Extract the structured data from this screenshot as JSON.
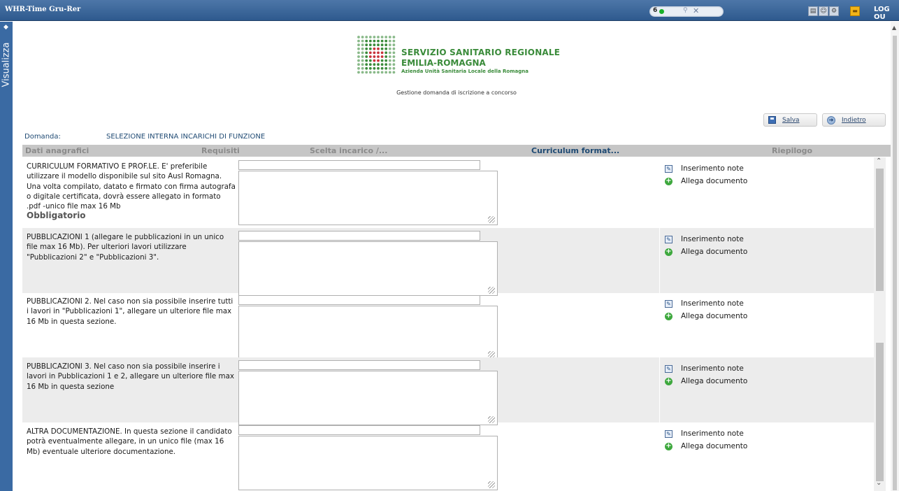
{
  "app": {
    "title": "WHR-Time Gru-Rer",
    "logout": "LOG OU"
  },
  "toolbar": {
    "notif_count": "6"
  },
  "sidebar": {
    "label": "Visualizza"
  },
  "logo": {
    "line1": "SERVIZIO SANITARIO REGIONALE",
    "line2": "EMILIA-ROMAGNA",
    "line3": "Azienda Unità Sanitaria Locale della Romagna"
  },
  "page": {
    "subtitle": "Gestione domanda di iscrizione a concorso"
  },
  "buttons": {
    "save": "Salva",
    "back": "Indietro"
  },
  "domanda": {
    "label": "Domanda:",
    "value": "SELEZIONE INTERNA INCARICHI DI FUNZIONE"
  },
  "tabs": [
    {
      "label": "Dati anagrafici"
    },
    {
      "label": "Requisiti"
    },
    {
      "label": "Scelta incarico /..."
    },
    {
      "label": "Curriculum format..."
    },
    {
      "label": "Riepilogo"
    }
  ],
  "actions": {
    "note": "Inserimento note",
    "attach": "Allega documento"
  },
  "sections": [
    {
      "text": "CURRICULUM FORMATIVO E PROF.LE. E' preferibile utilizzare il modello disponibile sul sito Ausl Romagna. Una volta compilato, datato e firmato con firma autografa o digitale certificata, dovrà essere allegato in formato .pdf -unico file max 16 Mb",
      "required": "Obbligatorio",
      "value": "",
      "notes": ""
    },
    {
      "text": "PUBBLICAZIONI 1 (allegare le pubblicazioni in un unico file max 16 Mb). Per ulteriori lavori utilizzare \"Pubblicazioni 2\" e \"Pubblicazioni 3\".",
      "required": "",
      "value": "",
      "notes": ""
    },
    {
      "text": "PUBBLICAZIONI 2. Nel caso non sia possibile inserire tutti i lavori in \"Pubblicazioni 1\", allegare un ulteriore file max 16 Mb in questa sezione.",
      "required": "",
      "value": "",
      "notes": ""
    },
    {
      "text": "PUBBLICAZIONI 3. Nel caso non sia possibile inserire i lavori in Pubblicazioni 1 e 2, allegare un ulteriore file max 16 Mb in questa sezione",
      "required": "",
      "value": "",
      "notes": ""
    },
    {
      "text": "ALTRA DOCUMENTAZIONE. In questa sezione il candidato potrà eventualmente allegare, in un unico file (max 16 Mb) eventuale ulteriore documentazione.",
      "required": "",
      "value": "",
      "notes": ""
    }
  ],
  "colors": {
    "topbar": "#2e5a8e",
    "accent": "#1f4a73",
    "logo_green": "#3a8b3a",
    "logo_red": "#c8323a"
  }
}
